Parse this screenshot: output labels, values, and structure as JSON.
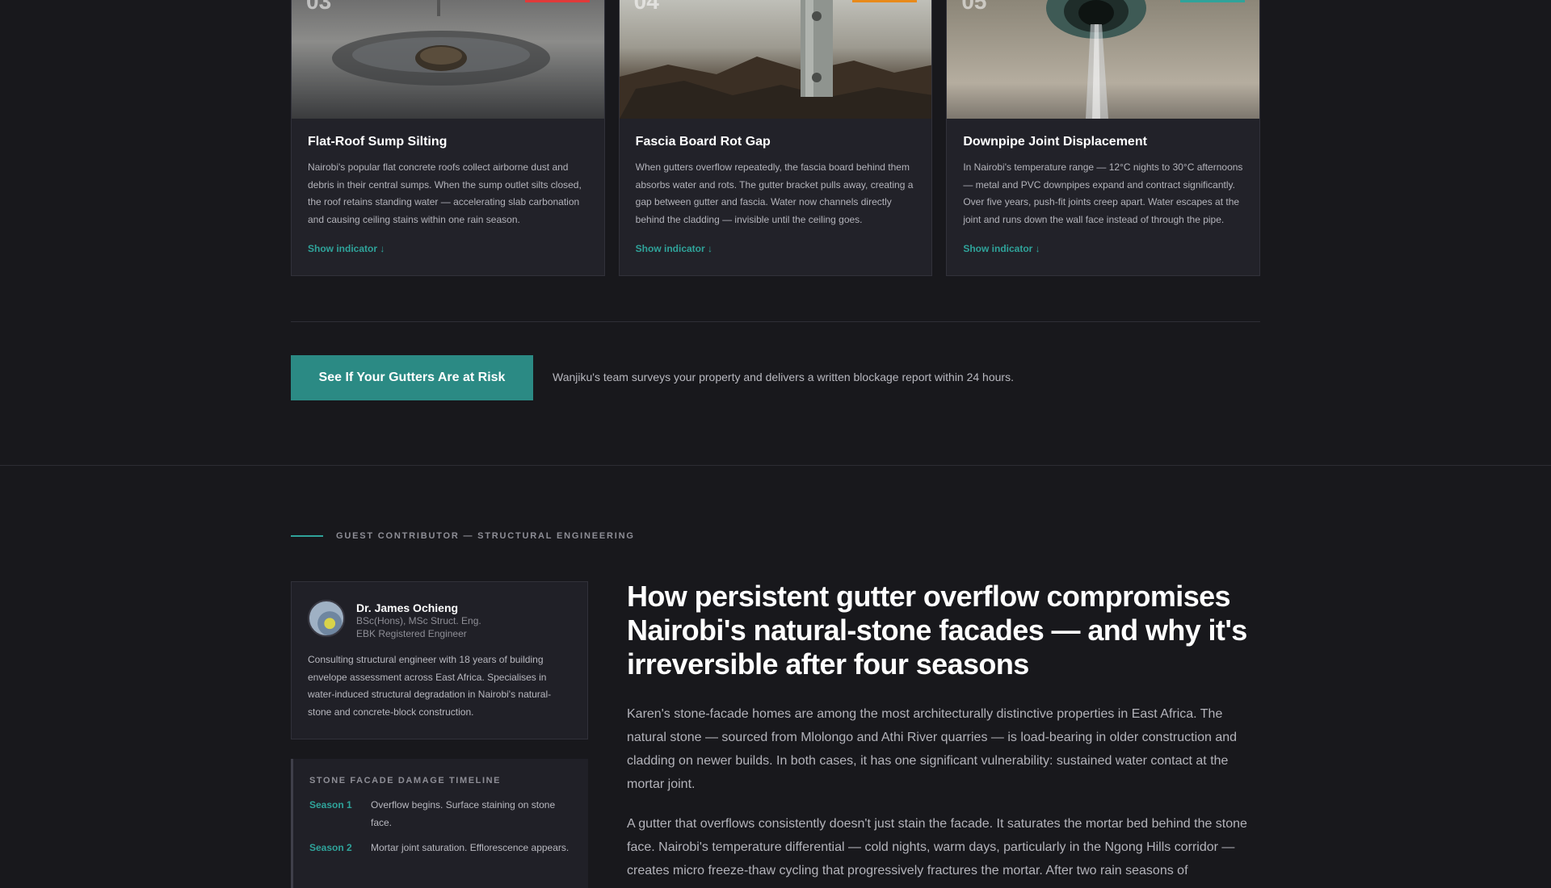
{
  "cards": [
    {
      "number": "03",
      "tag_color": "#e03a3a",
      "title": "Flat-Roof Sump Silting",
      "text": "Nairobi's popular flat concrete roofs collect airborne dust and debris in their central sumps. When the sump outlet silts closed, the roof retains standing water — accelerating slab carbonation and causing ceiling stains within one rain season.",
      "link": "Show indicator ↓"
    },
    {
      "number": "04",
      "tag_color": "#e88a1a",
      "title": "Fascia Board Rot Gap",
      "text": "When gutters overflow repeatedly, the fascia board behind them absorbs water and rots. The gutter bracket pulls away, creating a gap between gutter and fascia. Water now channels directly behind the cladding — invisible until the ceiling goes.",
      "link": "Show indicator ↓"
    },
    {
      "number": "05",
      "tag_color": "#2fa39a",
      "title": "Downpipe Joint Displacement",
      "text": "In Nairobi's temperature range — 12°C nights to 30°C afternoons — metal and PVC downpipes expand and contract significantly. Over five years, push-fit joints creep apart. Water escapes at the joint and runs down the wall face instead of through the pipe.",
      "link": "Show indicator ↓"
    }
  ],
  "cta": {
    "button": "See If Your Gutters Are at Risk",
    "note": "Wanjiku's team surveys your property and delivers a written blockage report within 24 hours."
  },
  "contributor": {
    "kicker": "GUEST CONTRIBUTOR — STRUCTURAL ENGINEERING",
    "name": "Dr. James Ochieng",
    "cred1": "BSc(Hons), MSc Struct. Eng.",
    "cred2": "EBK Registered Engineer",
    "bio": "Consulting structural engineer with 18 years of building envelope assessment across East Africa. Specialises in water-induced structural degradation in Nairobi's natural-stone and concrete-block construction."
  },
  "timeline": {
    "title": "STONE FACADE DAMAGE TIMELINE",
    "rows": [
      {
        "season": "Season 1",
        "desc": "Overflow begins. Surface staining on stone face."
      },
      {
        "season": "Season 2",
        "desc": "Mortar joint saturation. Efflorescence appears."
      }
    ]
  },
  "article": {
    "title": "How persistent gutter overflow compromises Nairobi's natural-stone facades — and why it's irreversible after four seasons",
    "p1": "Karen's stone-facade homes are among the most architecturally distinctive properties in East Africa. The natural stone — sourced from Mlolongo and Athi River quarries — is load-bearing in older construction and cladding on newer builds. In both cases, it has one significant vulnerability: sustained water contact at the mortar joint.",
    "p2": "A gutter that overflows consistently doesn't just stain the facade. It saturates the mortar bed behind the stone face. Nairobi's temperature differential — cold nights, warm days, particularly in the Ngong Hills corridor — creates micro freeze-thaw cycling that progressively fractures the mortar. After two rain seasons of"
  }
}
